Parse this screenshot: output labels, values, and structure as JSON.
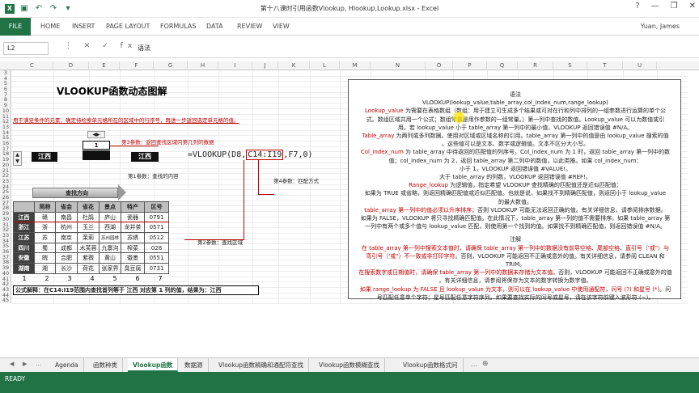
{
  "window": {
    "title": "第十八课时引用函数Vlookup, Hlookup,Lookup.xlsx - Excel",
    "help": "?",
    "minimize": "—",
    "restore": "❐",
    "close": "✕"
  },
  "ribbon": {
    "file": "FILE",
    "tabs": [
      "HOME",
      "INSERT",
      "PAGE LAYOUT",
      "FORMULAS",
      "DATA",
      "REVIEW",
      "VIEW"
    ],
    "user": "Yuan, James"
  },
  "formula_bar": {
    "name_box": "L2",
    "icons": "⋮ ✕ ✓ fx",
    "value": "语法"
  },
  "columns": [
    "C",
    "D",
    "E",
    "F",
    "G",
    "H",
    "I",
    "J",
    "K",
    "L",
    "M",
    "N",
    "O",
    "P",
    "Q",
    "R",
    "S",
    "T",
    "U"
  ],
  "rows": [
    "3",
    "4",
    "5",
    "6",
    "7",
    "8",
    "9",
    "10",
    "11",
    "12",
    "13",
    "14",
    "15",
    "16",
    "17",
    "18",
    "19",
    "20",
    "21",
    "22",
    "23",
    "24",
    "25",
    "26",
    "27",
    "28",
    "29",
    "30",
    "31",
    "32",
    "33",
    "34",
    "35",
    "36",
    "37",
    "38",
    "39",
    "40",
    "41",
    "42",
    "43",
    "44",
    "45"
  ],
  "left": {
    "title": "VLOOKUP函数动态图解",
    "desc": "用于满足条件的元素，确定待检索单元格所在的区域中的行序号，再进一步返回选定单元格的值。",
    "label_param3": "第3参数：返回查找区域内第几列的数据",
    "label_param1": "第1参数：查找的内容",
    "label_param4": "第4参数：匹配方式",
    "label_param2": "第2参数：查找区域",
    "lookup_value": "江西",
    "lookup_value2": "江西",
    "col_index": "1",
    "formula_prefix": "=VLOOKUP(D8,",
    "formula_range": "C14:I19",
    "formula_suffix": ",F7,0)",
    "search_dir": "查找方向",
    "table_headers": [
      "简称",
      "省会",
      "省花",
      "景点",
      "特产",
      "区号"
    ],
    "table_rows": [
      [
        "江西",
        "赣",
        "南昌",
        "杜鹃",
        "庐山",
        "瓷器",
        "0791"
      ],
      [
        "浙江",
        "浙",
        "杭州",
        "玉兰",
        "西湖",
        "龙井茶",
        "0571"
      ],
      [
        "江苏",
        "苏",
        "南京",
        "茉莉",
        "苏州园林",
        "苏绣",
        "0512"
      ],
      [
        "四川",
        "蜀",
        "成都",
        "木芙蓉",
        "九寨沟",
        "榨菜",
        "028"
      ],
      [
        "安徽",
        "皖",
        "合肥",
        "紫薇",
        "黄山",
        "徽墨",
        "0551"
      ],
      [
        "湖南",
        "湘",
        "长沙",
        "荷花",
        "张家界",
        "臭豆腐",
        "0731"
      ]
    ],
    "col_numbers": [
      "1",
      "2",
      "3",
      "4",
      "5",
      "6",
      "7"
    ],
    "explain": "公式解释：在C14:I19范围内查找首列等于 江西 对应第 1 列的值，结果为：江西"
  },
  "panel": {
    "h_syntax": "语法",
    "syntax": "VLOOKUP(lookup_value,table_array,col_index_num,range_lookup)",
    "lines": [
      [
        [
          "r",
          "Lookup_value"
        ],
        [
          "",
          "  为需要在表格数组（数组：用于建立可生成多个结果或可对在行和列中排列的一组参数进行运算的单个公"
        ]
      ],
      [
        [
          "",
          "式。数组区域共用一个公式；数组常量是用作参数的一组常量。）第一列中查找的数值。Lookup_value 可以为数值或引"
        ]
      ],
      [
        [
          "",
          "用。若 lookup_value 小于 table_array 第一列中的最小值，VLOOKUP 返回错误值 #N/A。"
        ]
      ],
      [
        [
          "r",
          "Table_array"
        ],
        [
          "",
          "  为两列或多列数据。使用对区域或区域名称的引用。table_array 第一列中的值是由 lookup_value 搜索的值"
        ]
      ],
      [
        [
          "",
          "。这些值可以是文本、数字或逻辑值。文本不区分大小写。"
        ]
      ],
      [
        [
          "r",
          "Col_index_num"
        ],
        [
          "",
          "  为 table_array 中待返回的匹配值的列序号。Col_index_num 为 1 时，返回 table_array 第一列中的数"
        ]
      ],
      [
        [
          "",
          "值；col_index_num 为 2，返回 table_array 第二列中的数值，以此类推。如果 col_index_num："
        ]
      ],
      [
        [
          "",
          "小于 1，VLOOKUP 返回错误值 #VALUE!。"
        ]
      ],
      [
        [
          "",
          "大于 table_array 的列数，VLOOKUP 返回错误值 #REF!。"
        ]
      ],
      [
        [
          "r",
          "Range_lookup"
        ],
        [
          "",
          "  为逻辑值，指定希望 VLOOKUP 查找精确的匹配值还是近似匹配值："
        ]
      ],
      [
        [
          "",
          "如果为 TRUE 或省略，则返回精确匹配值或近似匹配值。也就是说，如果找不到精确匹配值，则返回小于 lookup_value"
        ]
      ],
      [
        [
          "",
          "的最大数值。"
        ]
      ],
      [
        [
          "r",
          "table_array 第一列中的值必须以升序排序"
        ],
        [
          "",
          "；否则 VLOOKUP 可能无法返回正确的值。有关详细信息，请参阅排序数据。"
        ]
      ],
      [
        [
          "",
          "如果为 FALSE，VLOOKUP 将只寻找精确匹配值。在此情况下，table_array 第一列的值不需要排序。如果 table_array 第"
        ]
      ],
      [
        [
          "",
          "一列中有两个或多个值与 lookup_value 匹配，则使用第一个找到的值。如果找不到精确匹配值，则返回错误值 #N/A。"
        ]
      ]
    ],
    "h_notes": "注解",
    "notes": [
      [
        [
          "r",
          "在 table_array 第一列中搜索文本值时，请确保 table_array 第一列中的数据没有前导空格、尾部空格、直引号（'或\"）与"
        ]
      ],
      [
        [
          "r",
          "弯引号（'或\"）不一致或非打印字符"
        ],
        [
          "",
          "。否则，VLOOKUP 可能返回不正确或意外的值。有关详细信息，请参阅 CLEAN 和"
        ]
      ],
      [
        [
          "",
          "TRIM。"
        ]
      ],
      [
        [
          "r",
          "在搜索数字或日期值时，请确保 table_array 第一列中的数据未存储为文本值"
        ],
        [
          "",
          "。否则，VLOOKUP 可能返回不正确或意外的值"
        ]
      ],
      [
        [
          "",
          "。有关详细信息，请参阅将保存为文本的数字转换为数字值。"
        ]
      ],
      [
        [
          "r",
          "如果 range_lookup 为 FALSE 且 lookup_value 为文本，则可以在 lookup_value 中使用通配符，问号 (?) 和星号 (*)"
        ],
        [
          "",
          "。问"
        ]
      ],
      [
        [
          "",
          "号匹配任意单个字符；星号匹配任意字符序列。如果要查找实际的问号或星号，请在该字符前键入波形符 (~)。"
        ]
      ]
    ]
  },
  "sheets": {
    "nav": [
      "◀",
      "▶",
      "…"
    ],
    "tabs": [
      "Agenda",
      "函数种类",
      "Vlookup函数",
      "数据源",
      "Vlookup函数精确和通配符查找",
      "Vlookup函数模糊查找",
      "Vlookup函数格式问"
    ],
    "active": 2,
    "more": "…",
    "add": "⊕"
  },
  "status": {
    "text": "READY"
  },
  "colors": {
    "excel_green": "#217346",
    "red": "#c00000"
  }
}
